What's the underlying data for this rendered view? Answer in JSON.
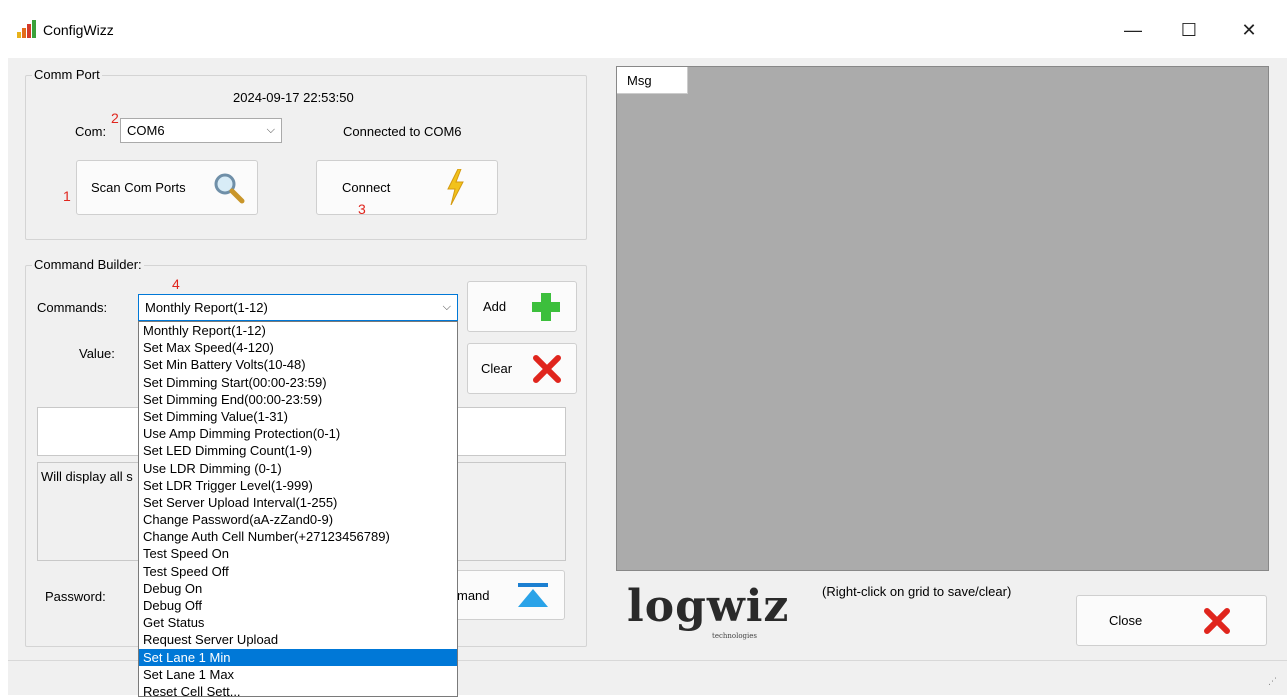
{
  "window": {
    "title": "ConfigWizz",
    "controls": {
      "minimize": "—",
      "maximize": "☐",
      "close": "✕"
    }
  },
  "comm_port": {
    "group_label": "Comm Port",
    "timestamp": "2024-09-17 22:53:50",
    "com_label": "Com:",
    "com_value": "COM6",
    "status": "Connected to COM6",
    "scan_button": "Scan Com Ports",
    "connect_button": "Connect",
    "step_markers": {
      "scan": "1",
      "com": "2",
      "connect": "3"
    }
  },
  "command_builder": {
    "group_label": "Command Builder:",
    "commands_label": "Commands:",
    "selected_command": "Monthly Report(1-12)",
    "step_marker": "4",
    "value_label": "Value:",
    "add_button": "Add",
    "clear_button": "Clear",
    "info_text": "Will display all s",
    "password_label": "Password:",
    "send_button_text": "mand",
    "dropdown_options": [
      "Monthly Report(1-12)",
      "Set Max Speed(4-120)",
      "Set Min Battery Volts(10-48)",
      "Set Dimming Start(00:00-23:59)",
      "Set Dimming End(00:00-23:59)",
      "Set Dimming Value(1-31)",
      "Use Amp Dimming Protection(0-1)",
      "Set LED Dimming Count(1-9)",
      "Use LDR Dimming (0-1)",
      "Set LDR Trigger Level(1-999)",
      "Set Server Upload Interval(1-255)",
      "Change Password(aA-zZand0-9)",
      "Change Auth Cell Number(+27123456789)",
      "Test Speed On",
      "Test Speed Off",
      "Debug On",
      "Debug Off",
      "Get Status",
      "Request Server Upload",
      "Set Lane 1 Min",
      "Set Lane 1 Max",
      "Reset Cell Sett..."
    ],
    "highlighted_index": 19
  },
  "message_panel": {
    "column_header": "Msg",
    "hint": "(Right-click on grid to save/clear)",
    "close_button": "Close"
  },
  "branding": {
    "logo_text": "logwiz",
    "logo_sub": "technologies"
  },
  "colors": {
    "accent": "#0078d7",
    "grid_bg": "#ababab",
    "marker_red": "#e0251d",
    "add_green": "#3cbf3c",
    "clear_red": "#e0251d"
  }
}
